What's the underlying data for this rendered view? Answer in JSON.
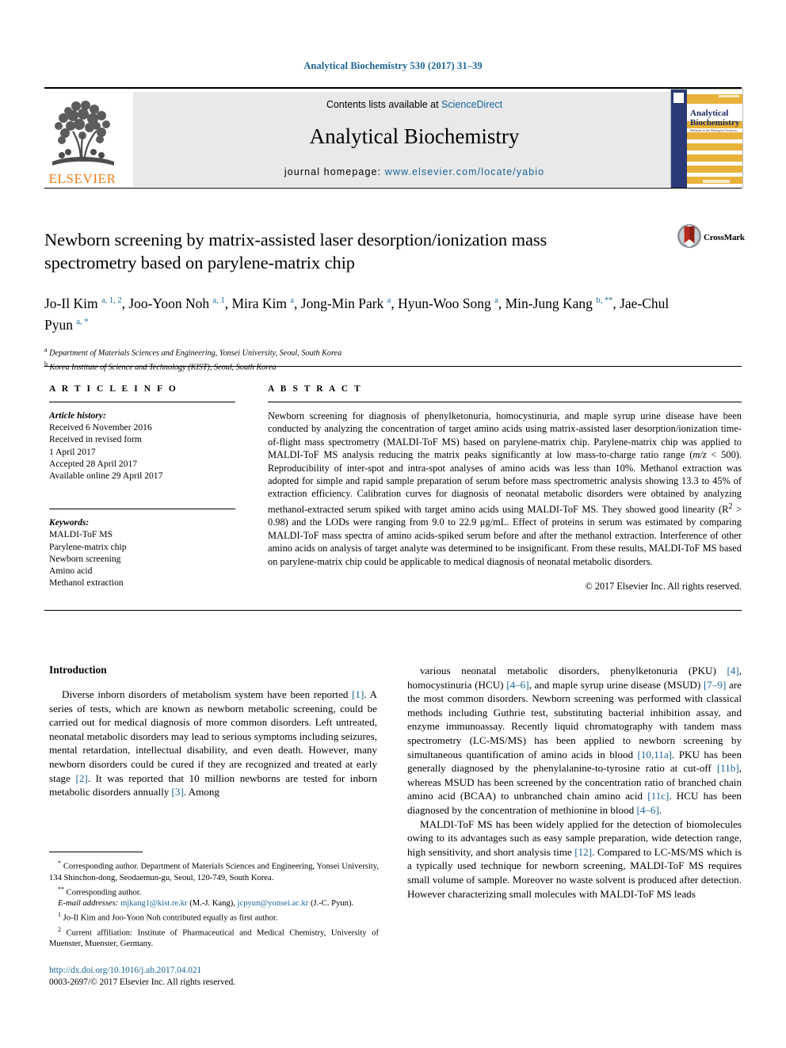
{
  "running_head": "Analytical Biochemistry 530 (2017) 31–39",
  "masthead": {
    "contents_prefix": "Contents lists available at ",
    "sciencedirect": "ScienceDirect",
    "journal_name": "Analytical Biochemistry",
    "homepage_prefix": "journal homepage: ",
    "homepage_url": "www.elsevier.com/locate/yabio",
    "publisher_wordmark": "ELSEVIER",
    "cover_title_line1": "Analytical",
    "cover_title_line2": "Biochemistry",
    "cover_subtitle": "Methods in the Biological Sciences"
  },
  "crossmark": {
    "label": "CrossMark"
  },
  "title": "Newborn screening by matrix-assisted laser desorption/ionization mass spectrometry based on parylene-matrix chip",
  "authors_html": "Jo-Il Kim <sup>a, 1, 2</sup>, Joo-Yoon Noh <sup>a, 1</sup>, Mira Kim <sup>a</sup>, Jong-Min Park <sup>a</sup>, Hyun-Woo Song <sup>a</sup>, Min-Jung Kang <sup>b, **</sup>, Jae-Chul Pyun <sup>a, *</sup>",
  "affiliations": [
    {
      "marker": "a",
      "text": "Department of Materials Sciences and Engineering, Yonsei University, Seoul, South Korea"
    },
    {
      "marker": "b",
      "text": "Korea Institute of Science and Technology (KIST), Seoul, South Korea"
    }
  ],
  "article_info": {
    "heading": "A R T I C L E  I N F O",
    "history_label": "Article history:",
    "history": [
      "Received 6 November 2016",
      "Received in revised form",
      "1 April 2017",
      "Accepted 28 April 2017",
      "Available online 29 April 2017"
    ],
    "keywords_label": "Keywords:",
    "keywords": [
      "MALDI-ToF MS",
      "Parylene-matrix chip",
      "Newborn screening",
      "Amino acid",
      "Methanol extraction"
    ]
  },
  "abstract": {
    "heading": "A B S T R A C T",
    "text": "Newborn screening for diagnosis of phenylketonuria, homocystinuria, and maple syrup urine disease have been conducted by analyzing the concentration of target amino acids using matrix-assisted laser desorption/ionization time-of-flight mass spectrometry (MALDI-ToF MS) based on parylene-matrix chip. Parylene-matrix chip was applied to MALDI-ToF MS analysis reducing the matrix peaks significantly at low mass-to-charge ratio range (m/z < 500). Reproducibility of inter-spot and intra-spot analyses of amino acids was less than 10%. Methanol extraction was adopted for simple and rapid sample preparation of serum before mass spectrometric analysis showing 13.3 to 45% of extraction efficiency. Calibration curves for diagnosis of neonatal metabolic disorders were obtained by analyzing methanol-extracted serum spiked with target amino acids using MALDI-ToF MS. They showed good linearity (R2 > 0.98) and the LODs were ranging from 9.0 to 22.9 μg/mL. Effect of proteins in serum was estimated by comparing MALDI-ToF mass spectra of amino acids-spiked serum before and after the methanol extraction. Interference of other amino acids on analysis of target analyte was determined to be insignificant. From these results, MALDI-ToF MS based on parylene-matrix chip could be applicable to medical diagnosis of neonatal metabolic disorders.",
    "copyright": "© 2017 Elsevier Inc. All rights reserved."
  },
  "body": {
    "intro_heading": "Introduction",
    "left_paragraph": "Diverse inborn disorders of metabolism system have been reported [1]. A series of tests, which are known as newborn metabolic screening, could be carried out for medical diagnosis of more common disorders. Left untreated, neonatal metabolic disorders may lead to serious symptoms including seizures, mental retardation, intellectual disability, and even death. However, many newborn disorders could be cured if they are recognized and treated at early stage [2]. It was reported that 10 million newborns are tested for inborn metabolic disorders annually [3]. Among",
    "right_paragraph_1": "various neonatal metabolic disorders, phenylketonuria (PKU) [4], homocystinuria (HCU) [4–6], and maple syrup urine disease (MSUD) [7–9] are the most common disorders. Newborn screening was performed with classical methods including Guthrie test, substituting bacterial inhibition assay, and enzyme immunoassay. Recently liquid chromatography with tandem mass spectrometry (LC-MS/MS) has been applied to newborn screening by simultaneous quantification of amino acids in blood [10,11a]. PKU has been generally diagnosed by the phenylalanine-to-tyrosine ratio at cut-off [11b], whereas MSUD has been screened by the concentration ratio of branched chain amino acid (BCAA) to unbranched chain amino acid [11c]. HCU has been diagnosed by the concentration of methionine in blood [4–6].",
    "right_paragraph_2": "MALDI-ToF MS has been widely applied for the detection of biomolecules owing to its advantages such as easy sample preparation, wide detection range, high sensitivity, and short analysis time [12]. Compared to LC-MS/MS which is a typically used technique for newborn screening, MALDI-ToF MS requires small volume of sample. Moreover no waste solvent is produced after detection. However characterizing small molecules with MALDI-ToF MS leads"
  },
  "footnotes": {
    "corresponding_1": "Corresponding author. Department of Materials Sciences and Engineering, Yonsei University, 134 Shinchon-dong, Seodaemun-gu, Seoul, 120-749, South Korea.",
    "corresponding_2": "Corresponding author.",
    "email_label": "E-mail addresses:",
    "email_1": "mjkang1@kist.re.kr",
    "email_1_owner": "(M.-J. Kang)",
    "email_2": "jcpyun@yonsei.ac.kr",
    "email_2_owner": "(J.-C. Pyun).",
    "note_1": "Jo-Il Kim and Joo-Yoon Noh contributed equally as first author.",
    "note_2": "Current affiliation: Institute of Pharmaceutical and Medical Chemistry, University of Muenster, Muenster, Germany."
  },
  "doi_block": {
    "doi_url": "http://dx.doi.org/10.1016/j.ab.2017.04.021",
    "issn_line": "0003-2697/© 2017 Elsevier Inc. All rights reserved."
  },
  "colors": {
    "link_blue": "#1a6496",
    "elsevier_orange": "#ef7c1a",
    "masthead_gray": "#e9e9e9",
    "cover_blue": "#2b3a76",
    "cover_gold": "#e8b23a"
  }
}
